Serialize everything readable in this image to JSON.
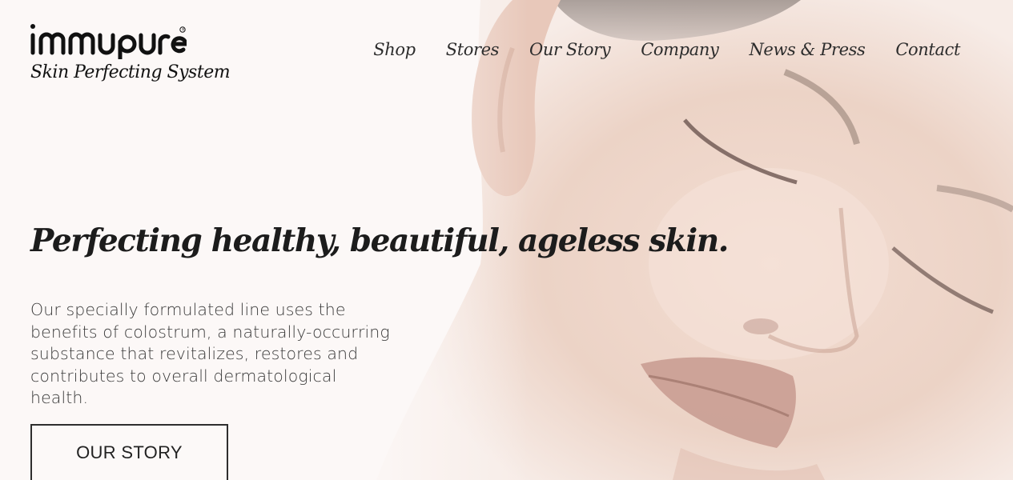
{
  "brand": {
    "name": "immupure",
    "registered_mark": "®",
    "tagline": "Skin Perfecting System"
  },
  "nav": {
    "items": [
      {
        "label": "Shop"
      },
      {
        "label": "Stores"
      },
      {
        "label": "Our Story"
      },
      {
        "label": "Company"
      },
      {
        "label": "News & Press"
      },
      {
        "label": "Contact"
      }
    ]
  },
  "hero": {
    "headline": "Perfecting healthy, beautiful, ageless skin.",
    "body": "Our specially formulated line uses the benefits of colostrum, a naturally-occurring substance that revitalizes, restores and contributes to overall dermatological health.",
    "cta_label": "OUR STORY",
    "image_icon": "face-portrait-illustration"
  },
  "colors": {
    "background": "#fcf8f7",
    "text": "#2a2a2a",
    "skin": "#ead0c3",
    "lips": "#b98a80"
  }
}
